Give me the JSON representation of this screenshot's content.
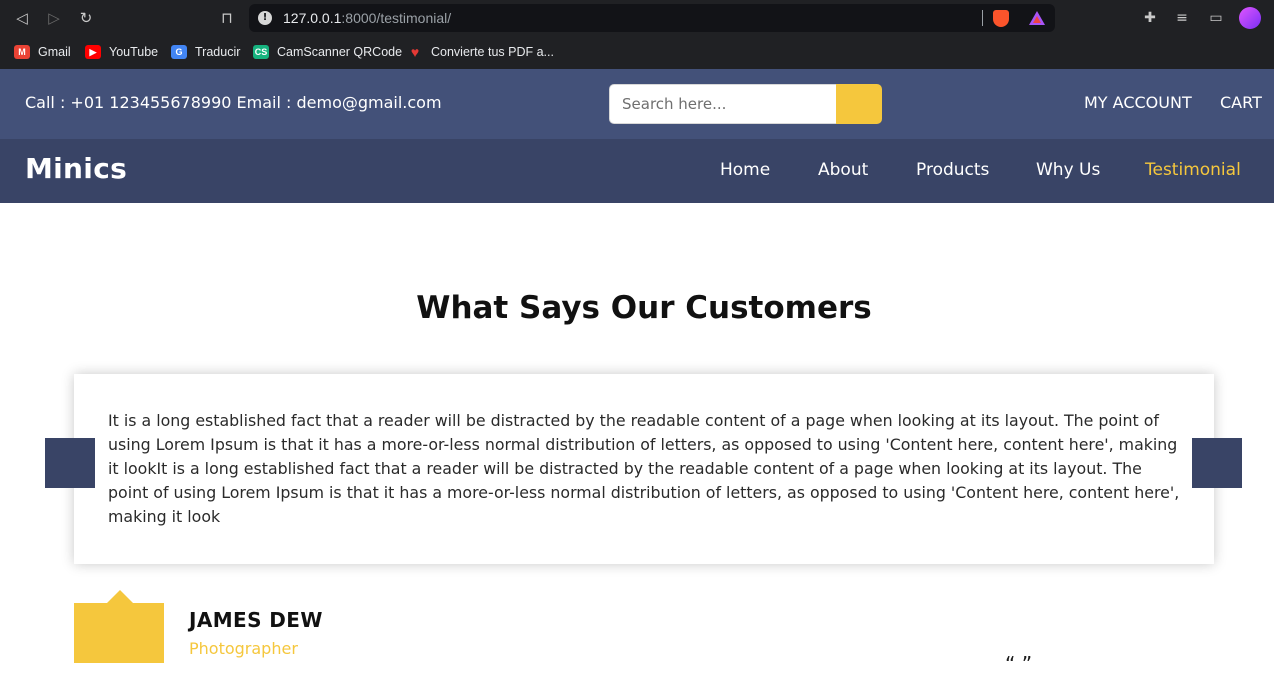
{
  "browser": {
    "url_host": "127.0.0.1",
    "url_path": ":8000/testimonial/",
    "bookmarks": [
      {
        "label": "Gmail",
        "icon": "gmail-icon",
        "color": "#ea4335"
      },
      {
        "label": "YouTube",
        "icon": "youtube-icon",
        "color": "#ff0000"
      },
      {
        "label": "Traducir",
        "icon": "translate-icon",
        "color": "#4285f4"
      },
      {
        "label": "CamScanner QRCode",
        "icon": "camscanner-icon",
        "color": "#16b37f"
      },
      {
        "label": "Convierte tus PDF a...",
        "icon": "pdf-heart-icon",
        "color": "#e53935"
      }
    ]
  },
  "topbar": {
    "contact": "Call : +01 123455678990  Email : demo@gmail.com",
    "search_placeholder": "Search here...",
    "account_label": "MY ACCOUNT",
    "cart_label": "CART"
  },
  "navbar": {
    "logo": "Minics",
    "links": [
      "Home",
      "About",
      "Products",
      "Why Us",
      "Testimonial"
    ],
    "active": "Testimonial"
  },
  "testimonial": {
    "title": "What Says Our Customers",
    "text": "It is a long established fact that a reader will be distracted by the readable content of a page when looking at its layout. The point of using Lorem Ipsum is that it has a more-or-less normal distribution of letters, as opposed to using 'Content here, content here', making it lookIt is a long established fact that a reader will be distracted by the readable content of a page when looking at its layout. The point of using Lorem Ipsum is that it has a more-or-less normal distribution of letters, as opposed to using 'Content here, content here', making it look",
    "author_name": "JAMES DEW",
    "author_role": "Photographer"
  },
  "colors": {
    "topbar": "#435179",
    "navbar": "#394466",
    "accent": "#f5c73d",
    "arrow": "#394466"
  }
}
